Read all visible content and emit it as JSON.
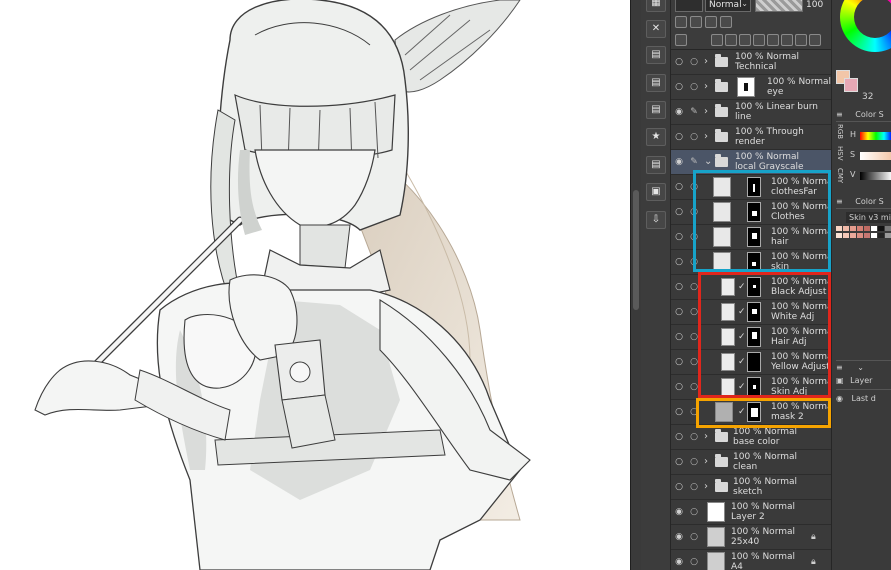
{
  "toolbar": {
    "blend_mode": "Normal",
    "opacity": "100"
  },
  "layers": [
    {
      "top": "100 % Normal",
      "name": "Technical"
    },
    {
      "top": "100 % Normal",
      "name": "eye"
    },
    {
      "top": "100 % Linear burn",
      "name": "line"
    },
    {
      "top": "100 % Through",
      "name": "render"
    },
    {
      "top": "100 % Normal",
      "name": "local Grayscale"
    },
    {
      "top": "100 % Normal",
      "name": "clothesFar"
    },
    {
      "top": "100 % Normal",
      "name": "Clothes"
    },
    {
      "top": "100 % Normal",
      "name": "hair"
    },
    {
      "top": "100 % Normal",
      "name": "skin"
    },
    {
      "top": "100 % Normal",
      "name": "Black Adjust"
    },
    {
      "top": "100 % Normal",
      "name": "White Adj"
    },
    {
      "top": "100 % Normal",
      "name": "Hair Adj"
    },
    {
      "top": "100 % Normal",
      "name": "Yellow Adjust"
    },
    {
      "top": "100 % Normal",
      "name": "Skin Adj"
    },
    {
      "top": "100 % Normal",
      "name": "mask 2"
    },
    {
      "top": "100 % Normal",
      "name": "base color"
    },
    {
      "top": "100 % Normal",
      "name": "clean"
    },
    {
      "top": "100 % Normal",
      "name": "sketch"
    },
    {
      "top": "100 % Normal",
      "name": "Layer 2"
    },
    {
      "top": "100 % Normal",
      "name": "25x40"
    },
    {
      "top": "100 % Normal",
      "name": "A4"
    }
  ],
  "right_panel": {
    "zoom_value": "32",
    "color_panel_tab": "Color S",
    "slider_labels": [
      "H",
      "S",
      "V"
    ],
    "color_panel_tab_2": "Color S",
    "swatch_set": "Skin v3 mi",
    "layer_tab": "Layer",
    "last_item": "Last d"
  },
  "annotation_colors": {
    "blue": "#17a3c9",
    "red": "#e0261c",
    "orange": "#f5a300"
  }
}
